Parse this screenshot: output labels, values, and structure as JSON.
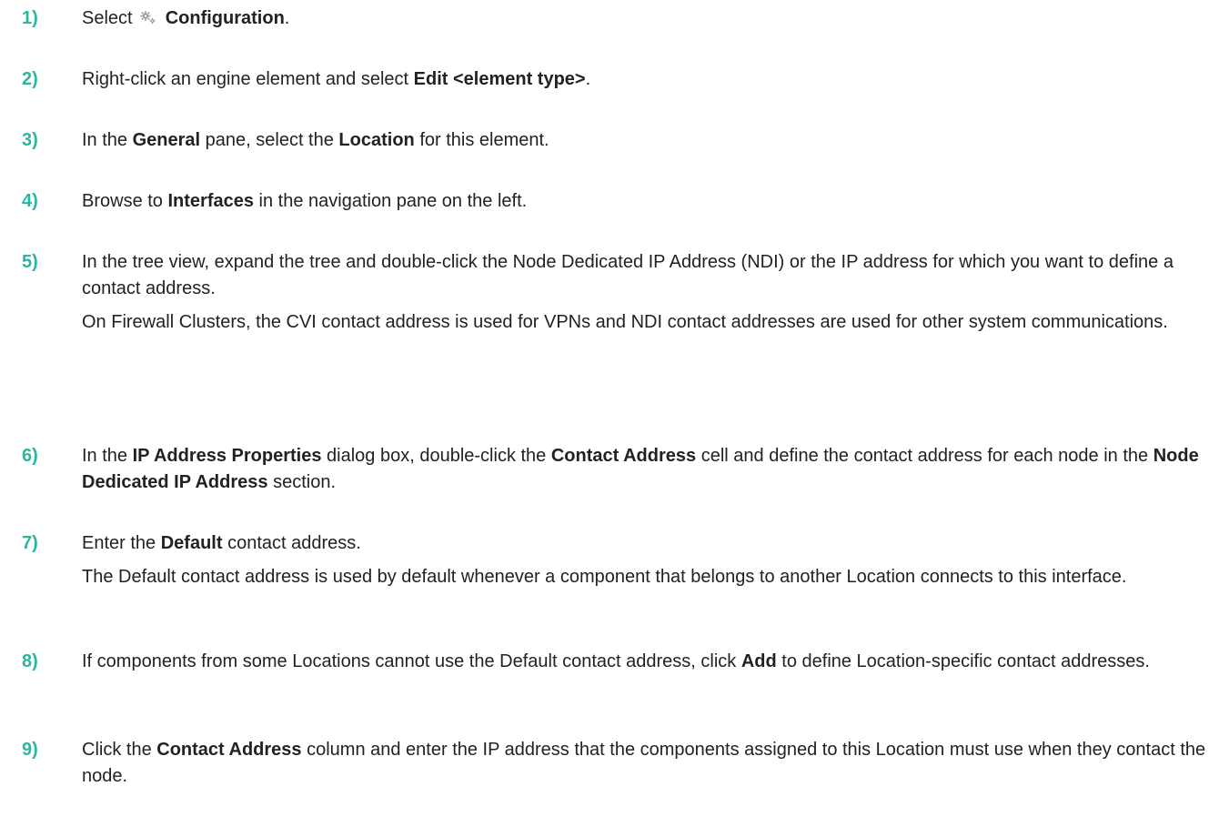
{
  "steps": [
    {
      "number": "1)",
      "paragraphs": [
        [
          {
            "text": "Select ",
            "bold": false
          },
          {
            "icon": "gear-icon"
          },
          {
            "text": " Configuration",
            "bold": true
          },
          {
            "text": ".",
            "bold": false
          }
        ]
      ]
    },
    {
      "number": "2)",
      "paragraphs": [
        [
          {
            "text": "Right-click an engine element and select ",
            "bold": false
          },
          {
            "text": "Edit <element type>",
            "bold": true
          },
          {
            "text": ".",
            "bold": false
          }
        ]
      ]
    },
    {
      "number": "3)",
      "paragraphs": [
        [
          {
            "text": "In the ",
            "bold": false
          },
          {
            "text": "General",
            "bold": true
          },
          {
            "text": " pane, select the ",
            "bold": false
          },
          {
            "text": "Location",
            "bold": true
          },
          {
            "text": " for this element.",
            "bold": false
          }
        ]
      ]
    },
    {
      "number": "4)",
      "paragraphs": [
        [
          {
            "text": "Browse to ",
            "bold": false
          },
          {
            "text": "Interfaces",
            "bold": true
          },
          {
            "text": " in the navigation pane on the left.",
            "bold": false
          }
        ]
      ]
    },
    {
      "number": "5)",
      "paragraphs": [
        [
          {
            "text": "In the tree view, expand the tree and double-click the Node Dedicated IP Address (NDI) or the IP address for which you want to define a contact address.",
            "bold": false
          }
        ],
        [
          {
            "text": "On Firewall Clusters, the CVI contact address is used for VPNs and NDI contact addresses are used for other system communications.",
            "bold": false
          }
        ]
      ]
    },
    {
      "number": "6)",
      "paragraphs": [
        [
          {
            "text": "In the ",
            "bold": false
          },
          {
            "text": "IP Address Properties",
            "bold": true
          },
          {
            "text": " dialog box, double-click the ",
            "bold": false
          },
          {
            "text": "Contact Address",
            "bold": true
          },
          {
            "text": " cell and define the contact address for each node in the ",
            "bold": false
          },
          {
            "text": "Node Dedicated IP Address",
            "bold": true
          },
          {
            "text": " section.",
            "bold": false
          }
        ]
      ]
    },
    {
      "number": "7)",
      "paragraphs": [
        [
          {
            "text": "Enter the ",
            "bold": false
          },
          {
            "text": "Default",
            "bold": true
          },
          {
            "text": " contact address.",
            "bold": false
          }
        ],
        [
          {
            "text": "The Default contact address is used by default whenever a component that belongs to another Location connects to this interface.",
            "bold": false
          }
        ]
      ]
    },
    {
      "number": "8)",
      "paragraphs": [
        [
          {
            "text": "If components from some Locations cannot use the Default contact address, click ",
            "bold": false
          },
          {
            "text": "Add",
            "bold": true
          },
          {
            "text": " to define Location-specific contact addresses.",
            "bold": false
          }
        ]
      ]
    },
    {
      "number": "9)",
      "paragraphs": [
        [
          {
            "text": "Click the ",
            "bold": false
          },
          {
            "text": "Contact Address",
            "bold": true
          },
          {
            "text": " column and enter the IP address that the components assigned to this Location must use when they contact the node.",
            "bold": false
          }
        ]
      ]
    }
  ]
}
